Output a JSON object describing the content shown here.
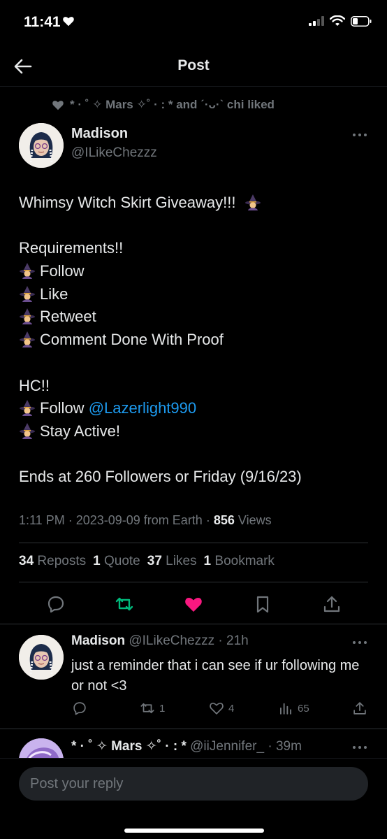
{
  "status": {
    "time": "11:41"
  },
  "nav": {
    "title": "Post"
  },
  "liked": {
    "text": "* · ˚ ✧ Mars ✧˚ · : * and ˊ·ᴗ·ˋ chi liked"
  },
  "post": {
    "author_name": "Madison",
    "author_handle": "@ILikeChezzz",
    "lines": {
      "title": "Whimsy Witch Skirt Giveaway!!!",
      "req_head": "Requirements!!",
      "req1": "Follow",
      "req2": "Like",
      "req3": "Retweet",
      "req4": "Comment Done With Proof",
      "hc_head": "HC!!",
      "hc1_prefix": "Follow ",
      "hc1_mention": "@Lazerlight990",
      "hc2": "Stay Active!",
      "ends": "Ends at 260 Followers or Friday (9/16/23)"
    },
    "meta": {
      "time": "1:11 PM",
      "date": "2023-09-09",
      "source": "from Earth",
      "views_count": "856",
      "views_label": "Views"
    },
    "stats": {
      "reposts_count": "34",
      "reposts_label": "Reposts",
      "quotes_count": "1",
      "quotes_label": "Quote",
      "likes_count": "37",
      "likes_label": "Likes",
      "bookmarks_count": "1",
      "bookmarks_label": "Bookmark"
    }
  },
  "reply": {
    "author_name": "Madison",
    "author_handle": "@ILikeChezzz",
    "age": "21h",
    "text": "just a reminder that i can see if ur following me or not <3",
    "reposts": "1",
    "likes": "4",
    "views": "65"
  },
  "next_reply": {
    "author_name": "* · ˚ ✧ Mars ✧˚ · : *",
    "author_handle": "@iiJennifer_",
    "age": "39m"
  },
  "composer": {
    "placeholder": "Post your reply"
  },
  "colors": {
    "accent": "#1d9bf0",
    "like": "#f91880",
    "repost": "#00ba7c",
    "muted": "#71767b"
  }
}
